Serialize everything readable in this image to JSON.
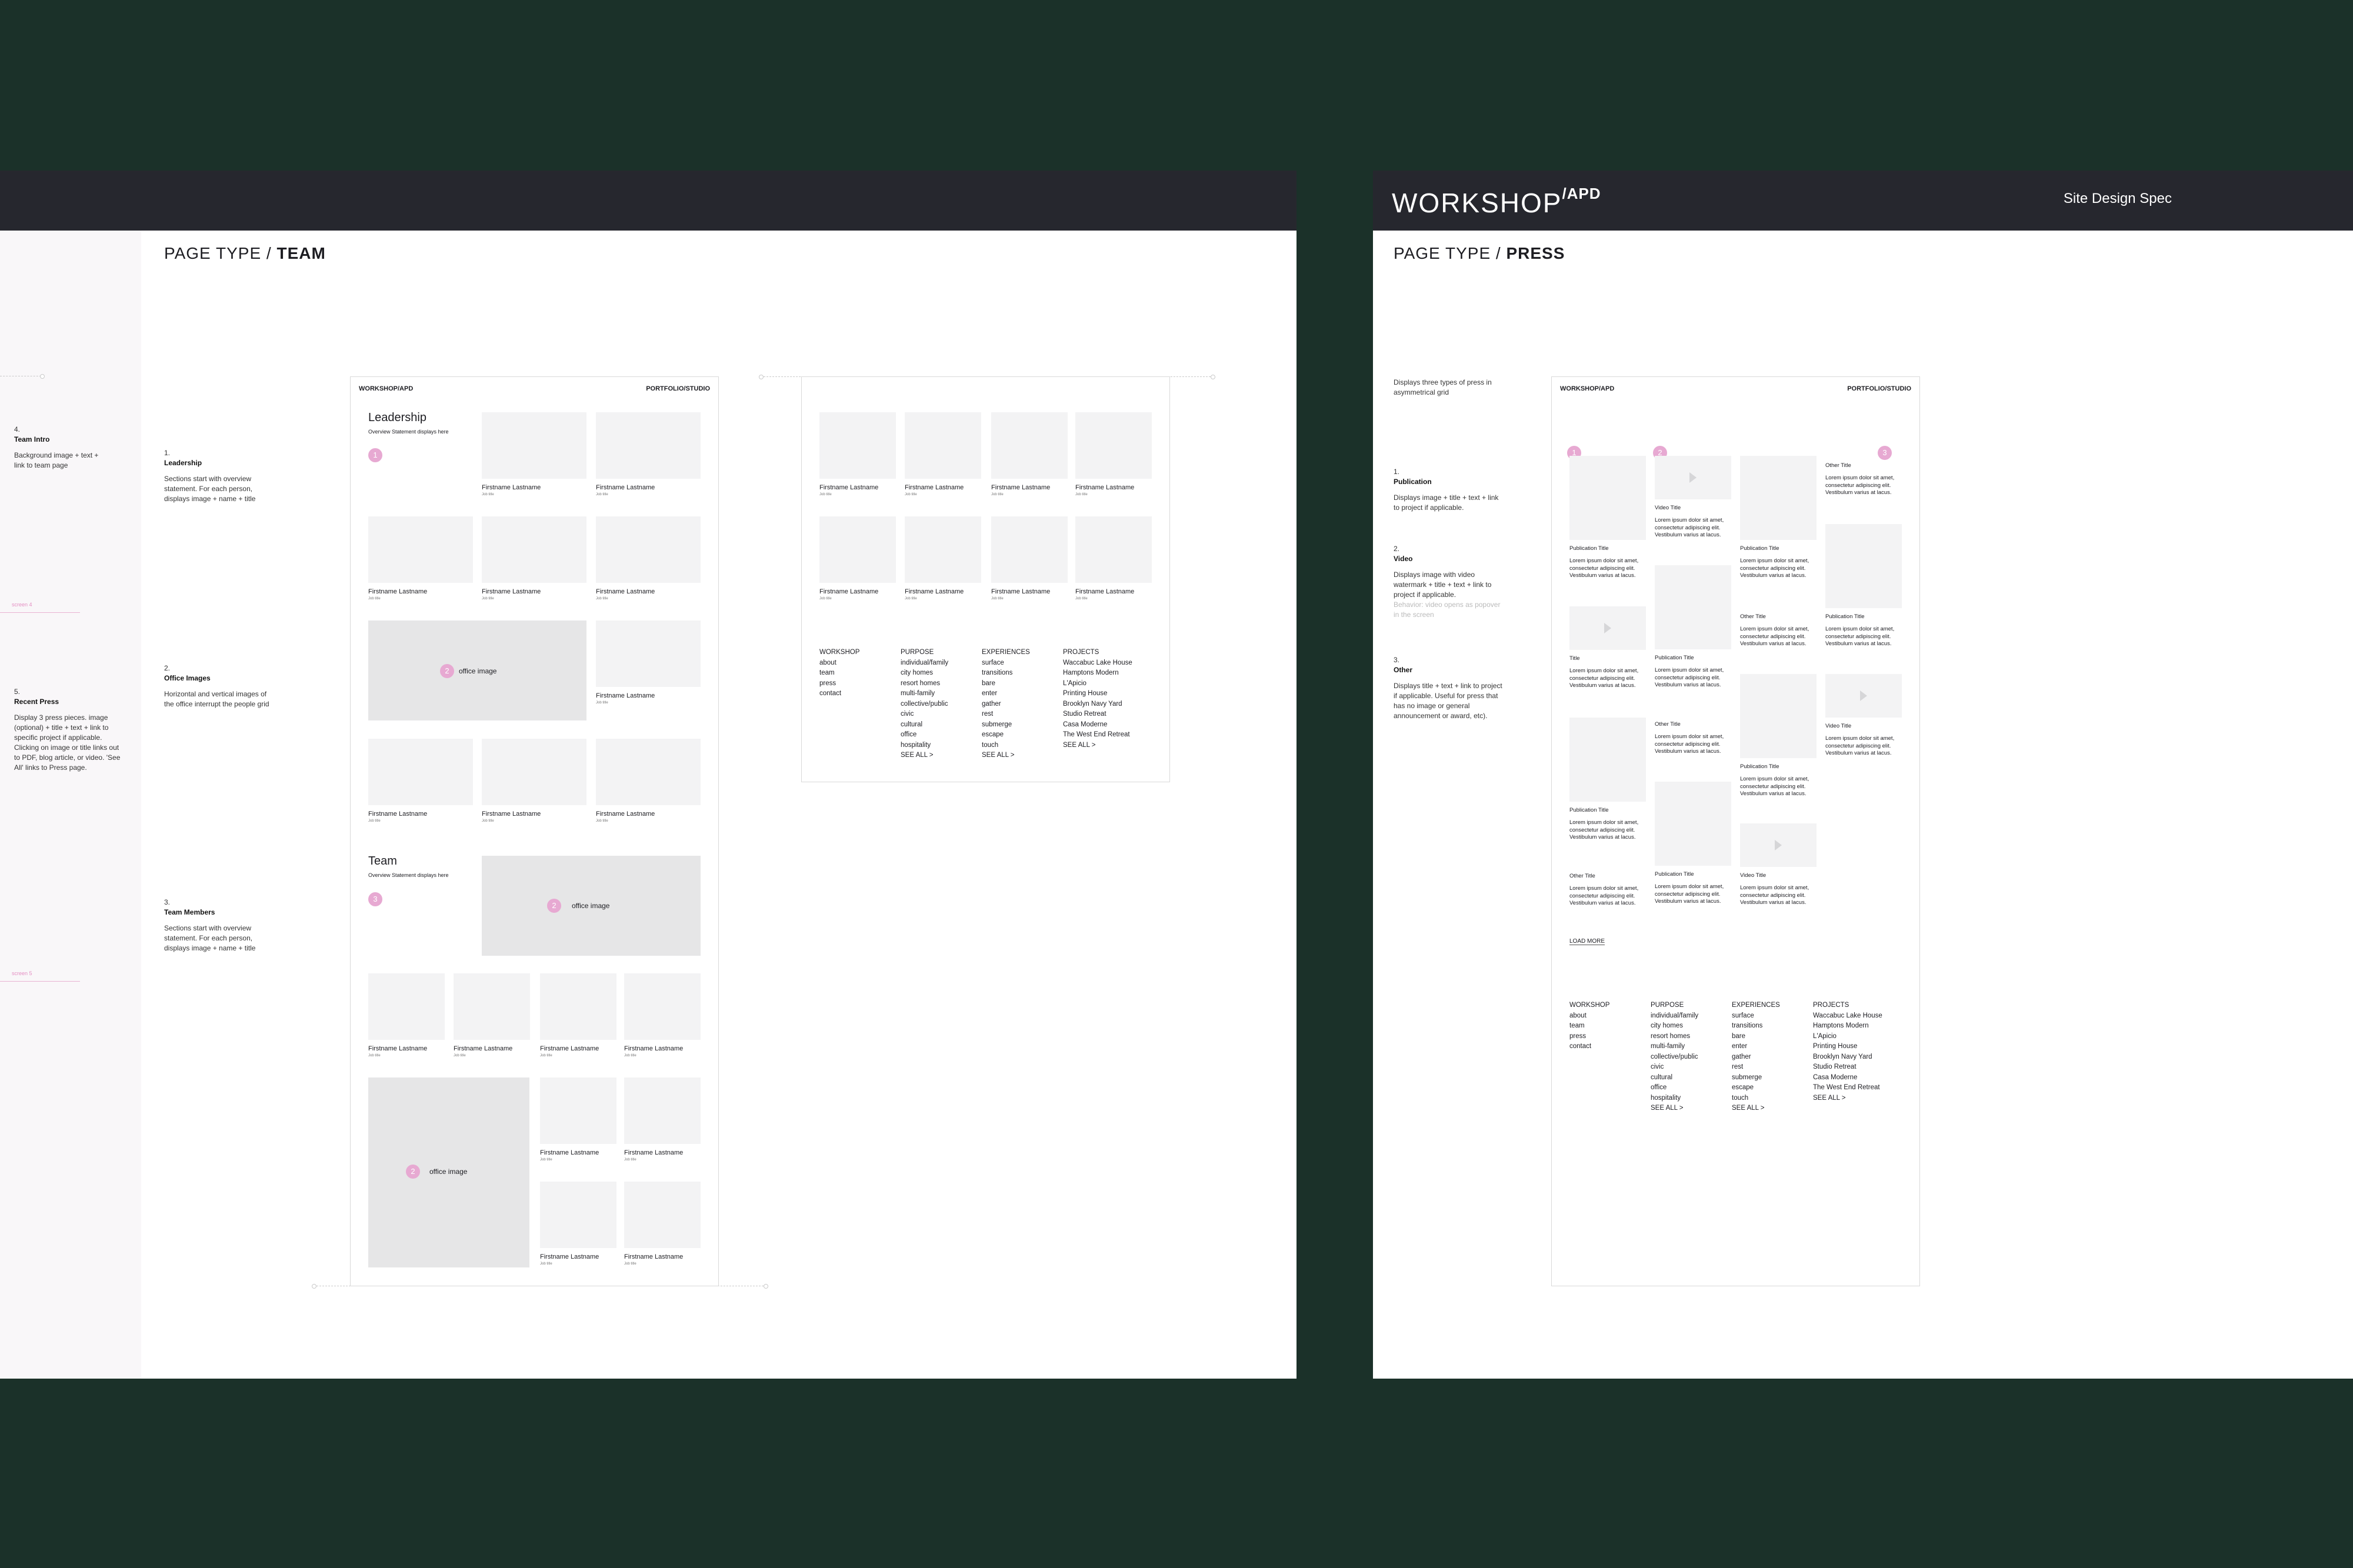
{
  "colors": {
    "background": "#1b3129",
    "header": "#26272e",
    "accent_pink": "#e7a9d2",
    "placeholder": "#f3f3f4"
  },
  "team_board": {
    "page_type_prefix": "PAGE TYPE",
    "page_type_sep": "/",
    "page_type_name": "TEAM",
    "left_notes": [
      {
        "num": "4.",
        "title": "Team Intro",
        "text": "Background image + text + link to team page"
      },
      {
        "num": "5.",
        "title": "Recent Press",
        "text": "Display 3 press pieces. image (optional) + title + text + link to specific project if applicable. Clicking on image or title links out to PDF, blog article, or video. 'See All' links to Press page."
      }
    ],
    "screen_labels": [
      "screen 4",
      "screen 5"
    ],
    "notes": [
      {
        "num": "1.",
        "title": "Leadership",
        "text": "Sections start with overview statement. For each person, displays image + name + title"
      },
      {
        "num": "2.",
        "title": "Office Images",
        "text": "Horizontal and vertical images of the office interrupt the people grid"
      },
      {
        "num": "3.",
        "title": "Team Members",
        "text": "Sections start with overview statement. For each person, displays image + name + title"
      }
    ],
    "wireframe": {
      "brand": "WORKSHOP/APD",
      "nav": "PORTFOLIO/STUDIO",
      "leadership_heading": "Leadership",
      "leadership_sub": "Overview Statement displays here",
      "team_heading": "Team",
      "team_sub": "Overview Statement displays here",
      "person_name": "Firstname Lastname",
      "person_title": "Job title",
      "office_image": "office image",
      "badges": [
        "1",
        "2",
        "3"
      ]
    },
    "footer": {
      "workshop": [
        "WORKSHOP",
        "about",
        "team",
        "press",
        "contact"
      ],
      "purpose": [
        "PURPOSE",
        "individual/family",
        "city homes",
        "resort homes",
        "multi-family",
        "collective/public",
        "civic",
        "cultural",
        "office",
        "hospitality",
        "SEE ALL >"
      ],
      "experiences": [
        "EXPERIENCES",
        "surface",
        "transitions",
        "bare",
        "enter",
        "gather",
        "rest",
        "submerge",
        "escape",
        "touch",
        "SEE ALL >"
      ],
      "projects": [
        "PROJECTS",
        "Waccabuc Lake House",
        "Hamptons Modern",
        "L'Apicio",
        "Printing House",
        "Brooklyn Navy Yard",
        "Studio Retreat",
        "Casa Moderne",
        "The West End Retreat",
        "SEE ALL >"
      ]
    }
  },
  "press_board": {
    "logo_main": "WORKSHOP",
    "logo_sup": "/APD",
    "spec_label": "Site Design Spec",
    "page_type_prefix": "PAGE TYPE",
    "page_type_sep": "/",
    "page_type_name": "PRESS",
    "intro": "Displays three types of press in asymmetrical grid",
    "notes": [
      {
        "num": "1.",
        "title": "Publication",
        "text": "Displays image + title + text + link to project if applicable."
      },
      {
        "num": "2.",
        "title": "Video",
        "text": "Displays image with video watermark + title + text + link to project if applicable.",
        "faint": "Behavior: video opens as popover in the screen"
      },
      {
        "num": "3.",
        "title": "Other",
        "text": "Displays title + text + link to project if applicable. Useful for press that has no image or general announcement or award, etc)."
      }
    ],
    "wireframe": {
      "brand": "WORKSHOP/APD",
      "nav": "PORTFOLIO/STUDIO",
      "publication_title": "Publication Title",
      "video_title": "Video Title",
      "other_title": "Other Title",
      "title": "Title",
      "lorem": "Lorem ipsum dolor sit amet, consectetur adipiscing elit. Vestibulum varius at lacus.",
      "load_more": "LOAD MORE",
      "badges": [
        "1",
        "2",
        "3"
      ]
    },
    "footer": {
      "workshop": [
        "WORKSHOP",
        "about",
        "team",
        "press",
        "contact"
      ],
      "purpose": [
        "PURPOSE",
        "individual/family",
        "city homes",
        "resort homes",
        "multi-family",
        "collective/public",
        "civic",
        "cultural",
        "office",
        "hospitality",
        "SEE ALL >"
      ],
      "experiences": [
        "EXPERIENCES",
        "surface",
        "transitions",
        "bare",
        "enter",
        "gather",
        "rest",
        "submerge",
        "escape",
        "touch",
        "SEE ALL >"
      ],
      "projects": [
        "PROJECTS",
        "Waccabuc Lake House",
        "Hamptons Modern",
        "L'Apicio",
        "Printing House",
        "Brooklyn Navy Yard",
        "Studio Retreat",
        "Casa Moderne",
        "The West End Retreat",
        "SEE ALL >"
      ]
    }
  }
}
